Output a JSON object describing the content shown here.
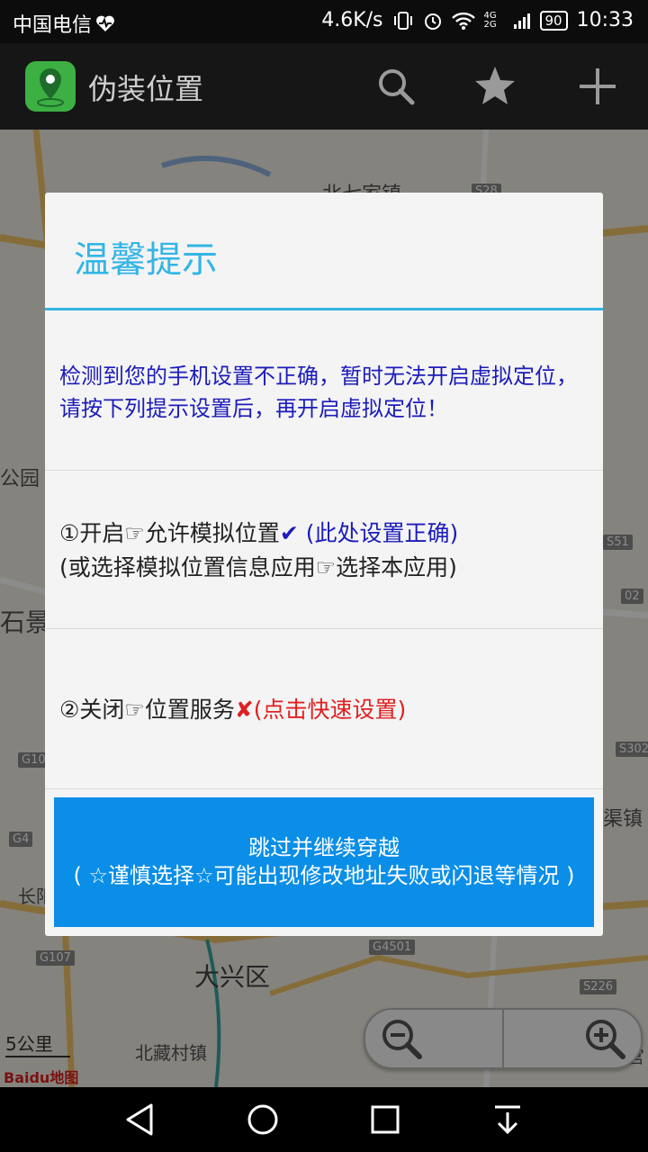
{
  "status_bar": {
    "carrier": "中国电信",
    "speed": "4.6K/s",
    "network": "4G 2G",
    "battery": "90",
    "time": "10:33",
    "icons": [
      "heart-monitor-icon",
      "vibrate-icon",
      "alarm-icon",
      "wifi-icon",
      "signal-icon",
      "battery-icon"
    ]
  },
  "app_bar": {
    "title": "伪装位置",
    "actions": [
      "search-icon",
      "star-icon",
      "add-icon"
    ]
  },
  "map": {
    "labels": [
      "北七家镇",
      "公园",
      "石景",
      "大兴区",
      "北藏村镇",
      "渠镇",
      "长阳",
      "宫"
    ],
    "road_badges": [
      "S28",
      "S51",
      "S302",
      "G4",
      "G107",
      "G4501",
      "S226",
      "G10",
      "02"
    ],
    "scale": "5公里",
    "logo": "Baidu地图"
  },
  "dialog": {
    "title": "温馨提示",
    "message": "检测到您的手机设置不正确，暂时无法开启虚拟定位，请按下列提示设置后，再开启虚拟定位！",
    "option1_main": "①开启☞允许模拟位置",
    "option1_check": "✔",
    "option1_status": " (此处设置正确)",
    "option1_alt": "(或选择模拟位置信息应用☞选择本应用)",
    "option2_main": "②关闭☞位置服务",
    "option2_cross": "✘",
    "option2_status": "(点击快速设置)",
    "skip_line1": "跳过并继续穿越",
    "skip_line2": "( ☆谨慎选择☆可能出现修改地址失败或闪退等情况 )"
  },
  "colors": {
    "accent": "#33b5e5",
    "button": "#0a8ee8",
    "ok_text": "#1c1cbb",
    "error_text": "#e02020"
  }
}
